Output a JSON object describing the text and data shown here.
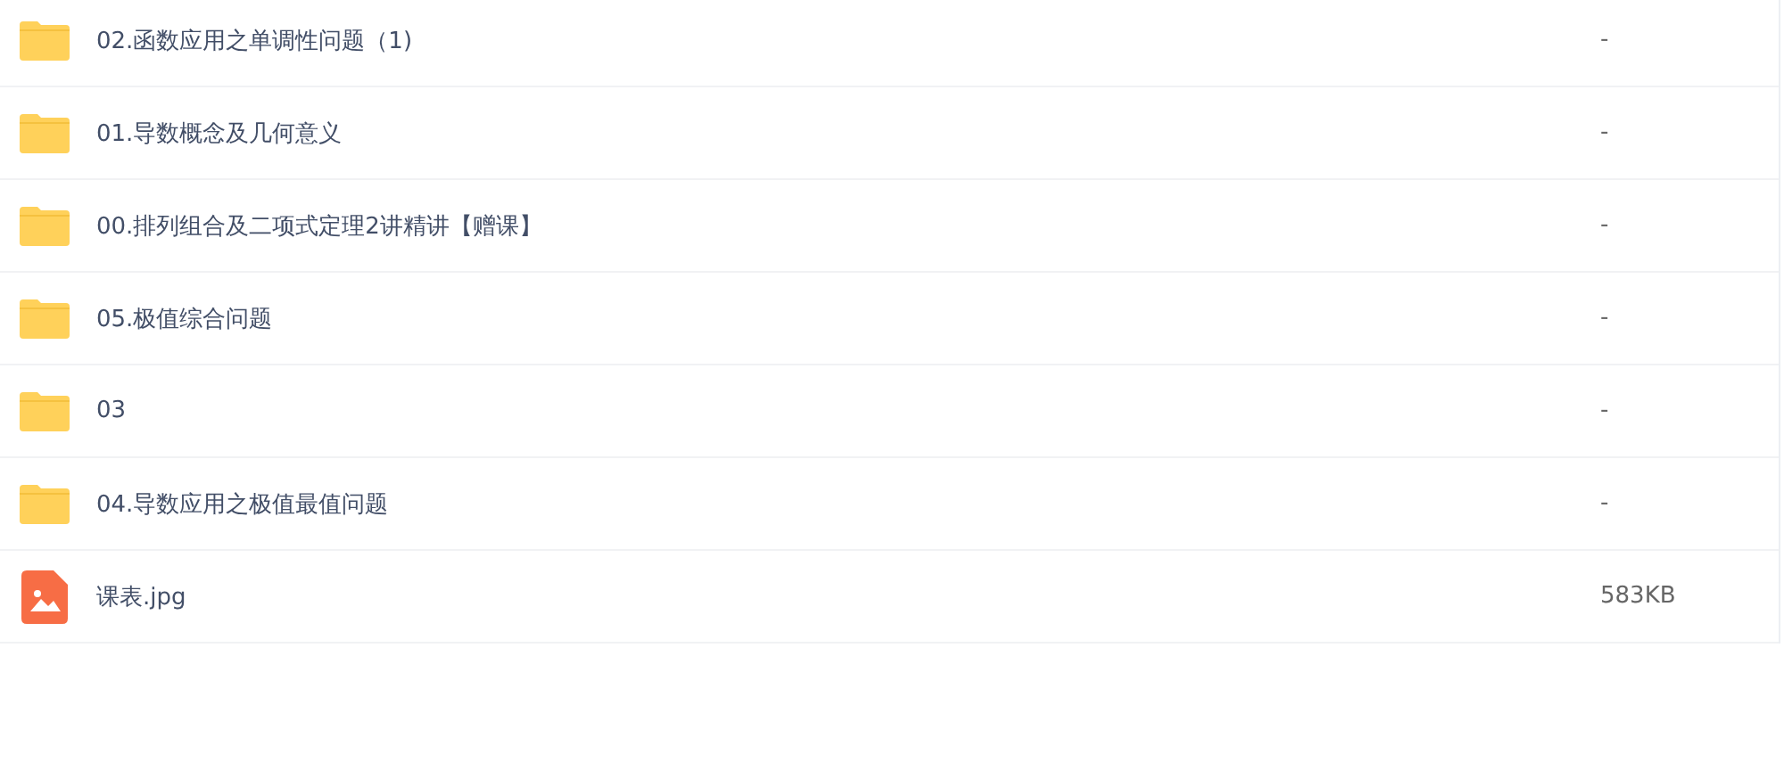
{
  "files": [
    {
      "kind": "folder",
      "name": "02.函数应用之单调性问题（1)",
      "size": "-"
    },
    {
      "kind": "folder",
      "name": "01.导数概念及几何意义",
      "size": "-"
    },
    {
      "kind": "folder",
      "name": "00.排列组合及二项式定理2讲精讲【赠课】",
      "size": "-"
    },
    {
      "kind": "folder",
      "name": "05.极值综合问题",
      "size": "-"
    },
    {
      "kind": "folder",
      "name": "03",
      "size": "-"
    },
    {
      "kind": "folder",
      "name": "04.导数应用之极值最值问题",
      "size": "-"
    },
    {
      "kind": "image",
      "name": "课表.jpg",
      "size": "583KB"
    }
  ]
}
